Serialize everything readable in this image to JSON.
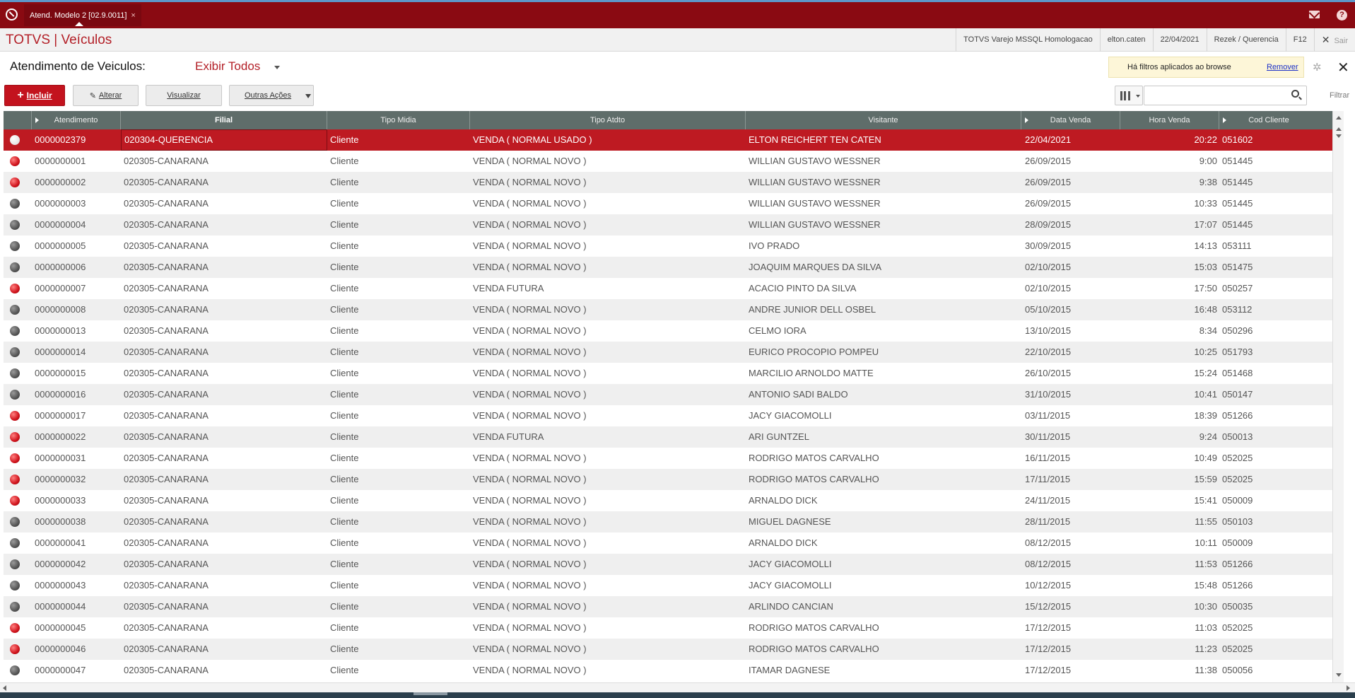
{
  "tab": {
    "label": "Atend. Modelo 2 [02.9.0011]",
    "close_glyph": "×"
  },
  "header": {
    "brand": "TOTVS | Veículos",
    "environment": "TOTVS Varejo MSSQL Homologacao",
    "user": "elton.caten",
    "date": "22/04/2021",
    "branch": "Rezek / Querencia",
    "shortcut": "F12",
    "exit_label": "Sair"
  },
  "page": {
    "title": "Atendimento de Veiculos:",
    "view_selector": "Exibir Todos",
    "filter_notice": "Há filtros aplicados ao browse",
    "remove_link": "Remover"
  },
  "toolbar": {
    "incluir": "Incluir",
    "alterar": "Alterar",
    "visualizar": "Visualizar",
    "outras": "Outras Ações",
    "search_placeholder": "",
    "filter_label": "Filtrar"
  },
  "icons": {
    "logo": "totvs-logo-icon",
    "mail": "mail-icon",
    "help": "help-icon",
    "gear": "gear-icon",
    "close": "close-icon",
    "search": "search-icon",
    "columns": "columns-icon"
  },
  "colors": {
    "brand_red": "#b31f27",
    "topbar": "#8a0a12",
    "selected_row": "#be1a22",
    "grid_header": "#5f6d6a"
  },
  "grid": {
    "columns": [
      "",
      "Atendimento",
      "Filial",
      "Tipo Midia",
      "Tipo Atdto",
      "Visitante",
      "Data Venda",
      "Hora Venda",
      "Cod Cliente"
    ],
    "rows": [
      {
        "status": "white",
        "atendimento": "0000002379",
        "filial": "020304-QUERENCIA",
        "midia": "Cliente",
        "atdto": "VENDA ( NORMAL USADO )",
        "visitante": "ELTON REICHERT TEN CATEN",
        "data": "22/04/2021",
        "hora": "20:22",
        "cliente": "051602"
      },
      {
        "status": "red",
        "atendimento": "0000000001",
        "filial": "020305-CANARANA",
        "midia": "Cliente",
        "atdto": "VENDA ( NORMAL NOVO )",
        "visitante": "WILLIAN GUSTAVO WESSNER",
        "data": "26/09/2015",
        "hora": "9:00",
        "cliente": "051445"
      },
      {
        "status": "red",
        "atendimento": "0000000002",
        "filial": "020305-CANARANA",
        "midia": "Cliente",
        "atdto": "VENDA ( NORMAL NOVO )",
        "visitante": "WILLIAN GUSTAVO WESSNER",
        "data": "26/09/2015",
        "hora": "9:38",
        "cliente": "051445"
      },
      {
        "status": "gray",
        "atendimento": "0000000003",
        "filial": "020305-CANARANA",
        "midia": "Cliente",
        "atdto": "VENDA ( NORMAL NOVO )",
        "visitante": "WILLIAN GUSTAVO WESSNER",
        "data": "26/09/2015",
        "hora": "10:33",
        "cliente": "051445"
      },
      {
        "status": "gray",
        "atendimento": "0000000004",
        "filial": "020305-CANARANA",
        "midia": "Cliente",
        "atdto": "VENDA ( NORMAL NOVO )",
        "visitante": "WILLIAN GUSTAVO WESSNER",
        "data": "28/09/2015",
        "hora": "17:07",
        "cliente": "051445"
      },
      {
        "status": "gray",
        "atendimento": "0000000005",
        "filial": "020305-CANARANA",
        "midia": "Cliente",
        "atdto": "VENDA ( NORMAL NOVO )",
        "visitante": "IVO PRADO",
        "data": "30/09/2015",
        "hora": "14:13",
        "cliente": "053111"
      },
      {
        "status": "gray",
        "atendimento": "0000000006",
        "filial": "020305-CANARANA",
        "midia": "Cliente",
        "atdto": "VENDA ( NORMAL NOVO )",
        "visitante": "JOAQUIM MARQUES DA SILVA",
        "data": "02/10/2015",
        "hora": "15:03",
        "cliente": "051475"
      },
      {
        "status": "red",
        "atendimento": "0000000007",
        "filial": "020305-CANARANA",
        "midia": "Cliente",
        "atdto": "VENDA FUTURA",
        "visitante": "ACACIO PINTO DA SILVA",
        "data": "02/10/2015",
        "hora": "17:50",
        "cliente": "050257"
      },
      {
        "status": "gray",
        "atendimento": "0000000008",
        "filial": "020305-CANARANA",
        "midia": "Cliente",
        "atdto": "VENDA ( NORMAL NOVO )",
        "visitante": "ANDRE JUNIOR DELL OSBEL",
        "data": "05/10/2015",
        "hora": "16:48",
        "cliente": "053112"
      },
      {
        "status": "gray",
        "atendimento": "0000000013",
        "filial": "020305-CANARANA",
        "midia": "Cliente",
        "atdto": "VENDA ( NORMAL NOVO )",
        "visitante": "CELMO IORA",
        "data": "13/10/2015",
        "hora": "8:34",
        "cliente": "050296"
      },
      {
        "status": "gray",
        "atendimento": "0000000014",
        "filial": "020305-CANARANA",
        "midia": "Cliente",
        "atdto": "VENDA ( NORMAL NOVO )",
        "visitante": "EURICO PROCOPIO POMPEU",
        "data": "22/10/2015",
        "hora": "10:25",
        "cliente": "051793"
      },
      {
        "status": "gray",
        "atendimento": "0000000015",
        "filial": "020305-CANARANA",
        "midia": "Cliente",
        "atdto": "VENDA ( NORMAL NOVO )",
        "visitante": "MARCILIO ARNOLDO MATTE",
        "data": "26/10/2015",
        "hora": "15:24",
        "cliente": "051468"
      },
      {
        "status": "gray",
        "atendimento": "0000000016",
        "filial": "020305-CANARANA",
        "midia": "Cliente",
        "atdto": "VENDA ( NORMAL NOVO )",
        "visitante": "ANTONIO SADI BALDO",
        "data": "31/10/2015",
        "hora": "10:41",
        "cliente": "050147"
      },
      {
        "status": "red",
        "atendimento": "0000000017",
        "filial": "020305-CANARANA",
        "midia": "Cliente",
        "atdto": "VENDA ( NORMAL NOVO )",
        "visitante": "JACY GIACOMOLLI",
        "data": "03/11/2015",
        "hora": "18:39",
        "cliente": "051266"
      },
      {
        "status": "red",
        "atendimento": "0000000022",
        "filial": "020305-CANARANA",
        "midia": "Cliente",
        "atdto": "VENDA FUTURA",
        "visitante": "ARI GUNTZEL",
        "data": "30/11/2015",
        "hora": "9:24",
        "cliente": "050013"
      },
      {
        "status": "red",
        "atendimento": "0000000031",
        "filial": "020305-CANARANA",
        "midia": "Cliente",
        "atdto": "VENDA ( NORMAL NOVO )",
        "visitante": "RODRIGO MATOS CARVALHO",
        "data": "16/11/2015",
        "hora": "10:49",
        "cliente": "052025"
      },
      {
        "status": "red",
        "atendimento": "0000000032",
        "filial": "020305-CANARANA",
        "midia": "Cliente",
        "atdto": "VENDA ( NORMAL NOVO )",
        "visitante": "RODRIGO MATOS CARVALHO",
        "data": "17/11/2015",
        "hora": "15:59",
        "cliente": "052025"
      },
      {
        "status": "red",
        "atendimento": "0000000033",
        "filial": "020305-CANARANA",
        "midia": "Cliente",
        "atdto": "VENDA ( NORMAL NOVO )",
        "visitante": "ARNALDO DICK",
        "data": "24/11/2015",
        "hora": "15:41",
        "cliente": "050009"
      },
      {
        "status": "gray",
        "atendimento": "0000000038",
        "filial": "020305-CANARANA",
        "midia": "Cliente",
        "atdto": "VENDA ( NORMAL NOVO )",
        "visitante": "MIGUEL DAGNESE",
        "data": "28/11/2015",
        "hora": "11:55",
        "cliente": "050103"
      },
      {
        "status": "gray",
        "atendimento": "0000000041",
        "filial": "020305-CANARANA",
        "midia": "Cliente",
        "atdto": "VENDA ( NORMAL NOVO )",
        "visitante": "ARNALDO DICK",
        "data": "08/12/2015",
        "hora": "10:11",
        "cliente": "050009"
      },
      {
        "status": "gray",
        "atendimento": "0000000042",
        "filial": "020305-CANARANA",
        "midia": "Cliente",
        "atdto": "VENDA ( NORMAL NOVO )",
        "visitante": "JACY GIACOMOLLI",
        "data": "08/12/2015",
        "hora": "11:53",
        "cliente": "051266"
      },
      {
        "status": "gray",
        "atendimento": "0000000043",
        "filial": "020305-CANARANA",
        "midia": "Cliente",
        "atdto": "VENDA ( NORMAL NOVO )",
        "visitante": "JACY GIACOMOLLI",
        "data": "10/12/2015",
        "hora": "15:48",
        "cliente": "051266"
      },
      {
        "status": "gray",
        "atendimento": "0000000044",
        "filial": "020305-CANARANA",
        "midia": "Cliente",
        "atdto": "VENDA ( NORMAL NOVO )",
        "visitante": "ARLINDO CANCIAN",
        "data": "15/12/2015",
        "hora": "10:30",
        "cliente": "050035"
      },
      {
        "status": "red",
        "atendimento": "0000000045",
        "filial": "020305-CANARANA",
        "midia": "Cliente",
        "atdto": "VENDA ( NORMAL NOVO )",
        "visitante": "RODRIGO MATOS CARVALHO",
        "data": "17/12/2015",
        "hora": "11:03",
        "cliente": "052025"
      },
      {
        "status": "red",
        "atendimento": "0000000046",
        "filial": "020305-CANARANA",
        "midia": "Cliente",
        "atdto": "VENDA ( NORMAL NOVO )",
        "visitante": "RODRIGO MATOS CARVALHO",
        "data": "17/12/2015",
        "hora": "11:23",
        "cliente": "052025"
      },
      {
        "status": "gray",
        "atendimento": "0000000047",
        "filial": "020305-CANARANA",
        "midia": "Cliente",
        "atdto": "VENDA ( NORMAL NOVO )",
        "visitante": "ITAMAR DAGNESE",
        "data": "17/12/2015",
        "hora": "11:38",
        "cliente": "050056"
      }
    ]
  }
}
